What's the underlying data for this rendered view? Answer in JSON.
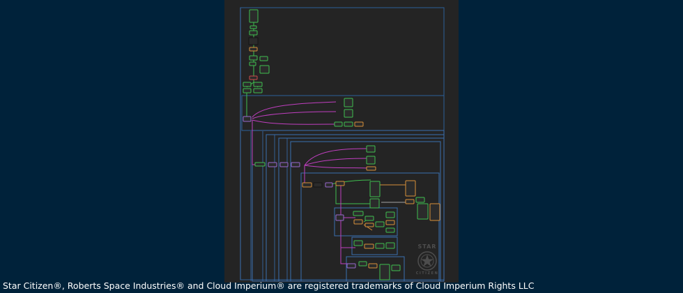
{
  "graph": {
    "tag_label": ""
  },
  "logo": {
    "line1": "STAR",
    "line2": "CITIZEN"
  },
  "footer": {
    "text": "Star Citizen®, Roberts Space Industries® and Cloud Imperium® are registered trademarks of Cloud Imperium Rights LLC"
  },
  "colors": {
    "page_background": "#00223a",
    "canvas_background": "#242424",
    "frame_blue": "#2b5f9a",
    "node_green": "#3fbf4f",
    "node_orange": "#d9913a",
    "node_purple": "#9a6ad0",
    "wire_magenta": "#c03fc0"
  }
}
